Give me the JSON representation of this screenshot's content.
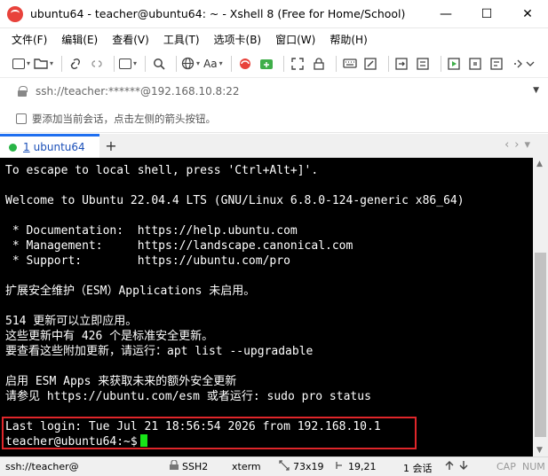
{
  "window": {
    "title": "ubuntu64 - teacher@ubuntu64: ~ - Xshell 8 (Free for Home/School)",
    "minimize": "—",
    "maximize": "☐",
    "close": "✕"
  },
  "menu": [
    "文件(F)",
    "编辑(E)",
    "查看(V)",
    "工具(T)",
    "选项卡(B)",
    "窗口(W)",
    "帮助(H)"
  ],
  "toolbar": {
    "font_button": "Aa"
  },
  "address": {
    "value": "ssh://teacher:******@192.168.10.8:22"
  },
  "hint": {
    "text": "要添加当前会话，点击左侧的箭头按钮。"
  },
  "tabs": [
    {
      "number": "1",
      "label": "ubuntu64",
      "status_color": "#28b446"
    }
  ],
  "tab_add": "+",
  "terminal": {
    "lines": [
      "To escape to local shell, press 'Ctrl+Alt+]'.",
      "Welcome to Ubuntu 22.04.4 LTS (GNU/Linux 6.8.0-124-generic x86_64)",
      " * Documentation:  https://help.ubuntu.com",
      " * Management:     https://landscape.canonical.com",
      " * Support:        https://ubuntu.com/pro",
      "扩展安全维护（ESM）Applications 未启用。",
      "514 更新可以立即应用。",
      "这些更新中有 426 个是标准安全更新。",
      "要查看这些附加更新，请运行：apt list --upgradable",
      "启用 ESM Apps 来获取未来的额外安全更新",
      "请参见 https://ubuntu.com/esm 或者运行: sudo pro status",
      "Last login: Tue Jul 21 18:56:54 2026 from 192.168.10.1",
      "teacher@ubuntu64:~$"
    ],
    "cursor_color": "#18e418"
  },
  "status": {
    "connection": "ssh://teacher@",
    "protocol": "SSH2",
    "terminal_type": "xterm",
    "size": "73x19",
    "position": "19,21",
    "sessions": "1 会话",
    "cap": "CAP",
    "num": "NUM"
  },
  "colors": {
    "accent": "#1e6ef0",
    "highlight_border": "#e0262a",
    "terminal_bg": "#000000"
  }
}
